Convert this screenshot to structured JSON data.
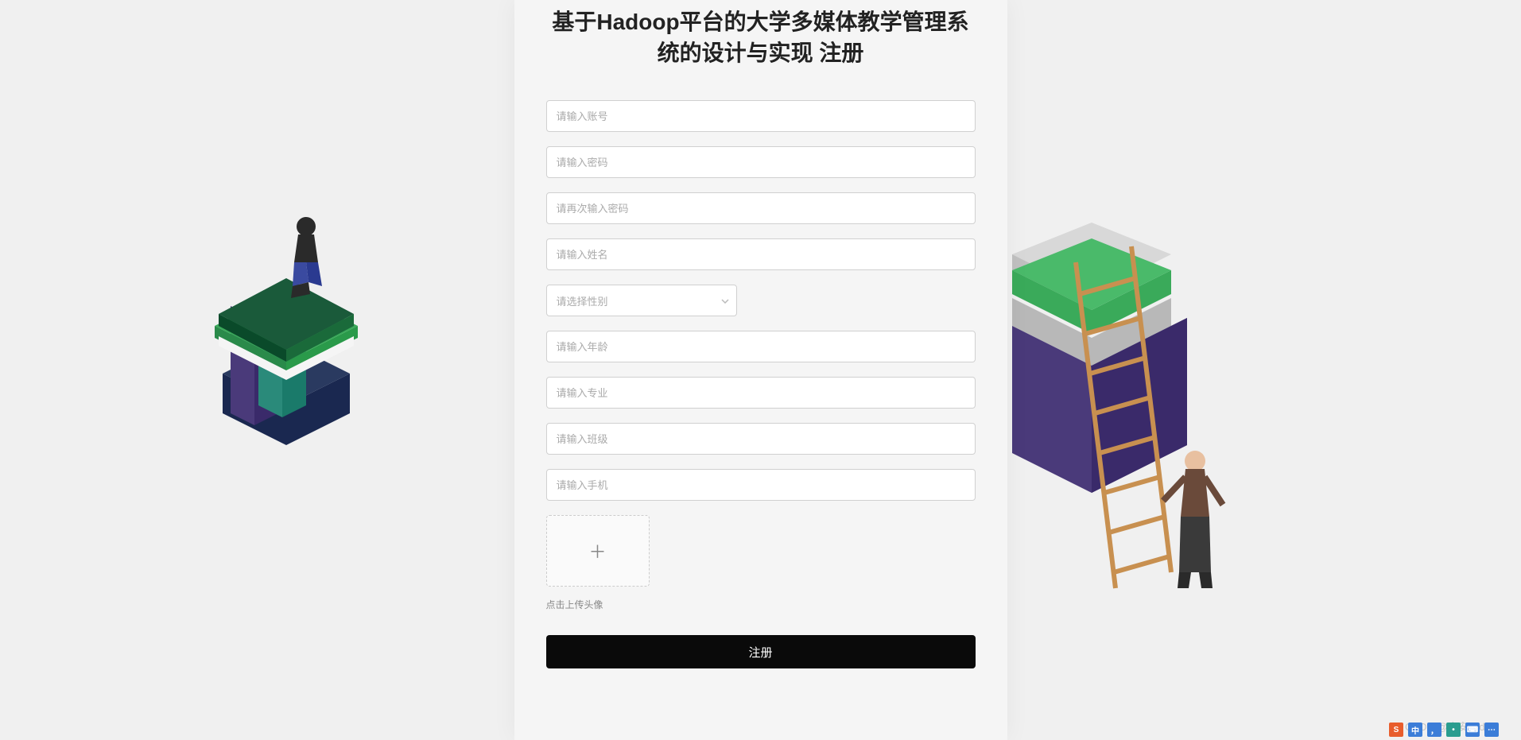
{
  "page": {
    "title": "基于Hadoop平台的大学多媒体教学管理系统的设计与实现 注册"
  },
  "form": {
    "account_placeholder": "请输入账号",
    "password_placeholder": "请输入密码",
    "password_confirm_placeholder": "请再次输入密码",
    "name_placeholder": "请输入姓名",
    "gender_placeholder": "请选择性别",
    "age_placeholder": "请输入年龄",
    "major_placeholder": "请输入专业",
    "class_placeholder": "请输入班级",
    "phone_placeholder": "请输入手机",
    "upload_label": "点击上传头像",
    "register_button": "注册"
  },
  "watermark": "CSDN @小安coding",
  "ime": {
    "icons": [
      "S",
      "中",
      ",",
      "•",
      "⌨",
      ""
    ]
  }
}
